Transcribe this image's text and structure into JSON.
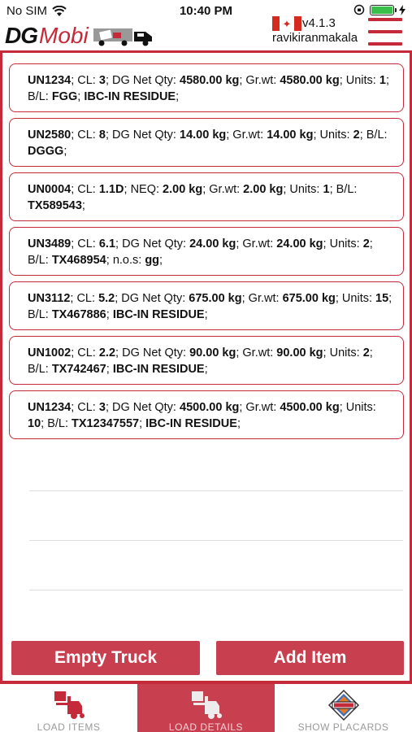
{
  "status_bar": {
    "carrier": "No SIM",
    "time": "10:40 PM"
  },
  "header": {
    "logo_dg": "DG",
    "logo_mobi": "Mobi",
    "version": "v4.1.3",
    "username": "ravikiranmakala"
  },
  "colors": {
    "brand_red": "#c42a3a",
    "button_red": "#c84050",
    "battery_green": "#39c04b"
  },
  "load_items": [
    {
      "un": "UN1234",
      "cl": "3",
      "qty_label": "DG Net Qty:",
      "qty": "4580.00 kg",
      "grwt": "4580.00 kg",
      "units": "1",
      "bl": "FGG",
      "extra": "IBC-IN RESIDUE"
    },
    {
      "un": "UN2580",
      "cl": "8",
      "qty_label": "DG Net Qty:",
      "qty": "14.00 kg",
      "grwt": "14.00 kg",
      "units": "2",
      "bl": "DGGG",
      "extra": ""
    },
    {
      "un": "UN0004",
      "cl": "1.1D",
      "qty_label": "NEQ:",
      "qty": "2.00 kg",
      "grwt": "2.00 kg",
      "units": "1",
      "bl": "TX589543",
      "extra": ""
    },
    {
      "un": "UN3489",
      "cl": "6.1",
      "qty_label": "DG Net Qty:",
      "qty": "24.00 kg",
      "grwt": "24.00 kg",
      "units": "2",
      "bl": "TX468954",
      "extra": "n.o.s: gg"
    },
    {
      "un": "UN3112",
      "cl": "5.2",
      "qty_label": "DG Net Qty:",
      "qty": "675.00 kg",
      "grwt": "675.00 kg",
      "units": "15",
      "bl": "TX467886",
      "extra": "IBC-IN RESIDUE"
    },
    {
      "un": "UN1002",
      "cl": "2.2",
      "qty_label": "DG Net Qty:",
      "qty": "90.00 kg",
      "grwt": "90.00 kg",
      "units": "2",
      "bl": "TX742467",
      "extra": "IBC-IN RESIDUE"
    },
    {
      "un": "UN1234",
      "cl": "3",
      "qty_label": "DG Net Qty:",
      "qty": "4500.00 kg",
      "grwt": "4500.00 kg",
      "units": "10",
      "bl": "TX12347557",
      "extra": "IBC-IN RESIDUE"
    }
  ],
  "actions": {
    "empty_truck": "Empty Truck",
    "add_item": "Add Item"
  },
  "tabs": [
    {
      "label": "LOAD ITEMS",
      "icon": "forklift-icon",
      "active": false
    },
    {
      "label": "LOAD DETAILS",
      "icon": "forklift-icon",
      "active": true
    },
    {
      "label": "SHOW PLACARDS",
      "icon": "danger-placard-icon",
      "active": false
    }
  ]
}
